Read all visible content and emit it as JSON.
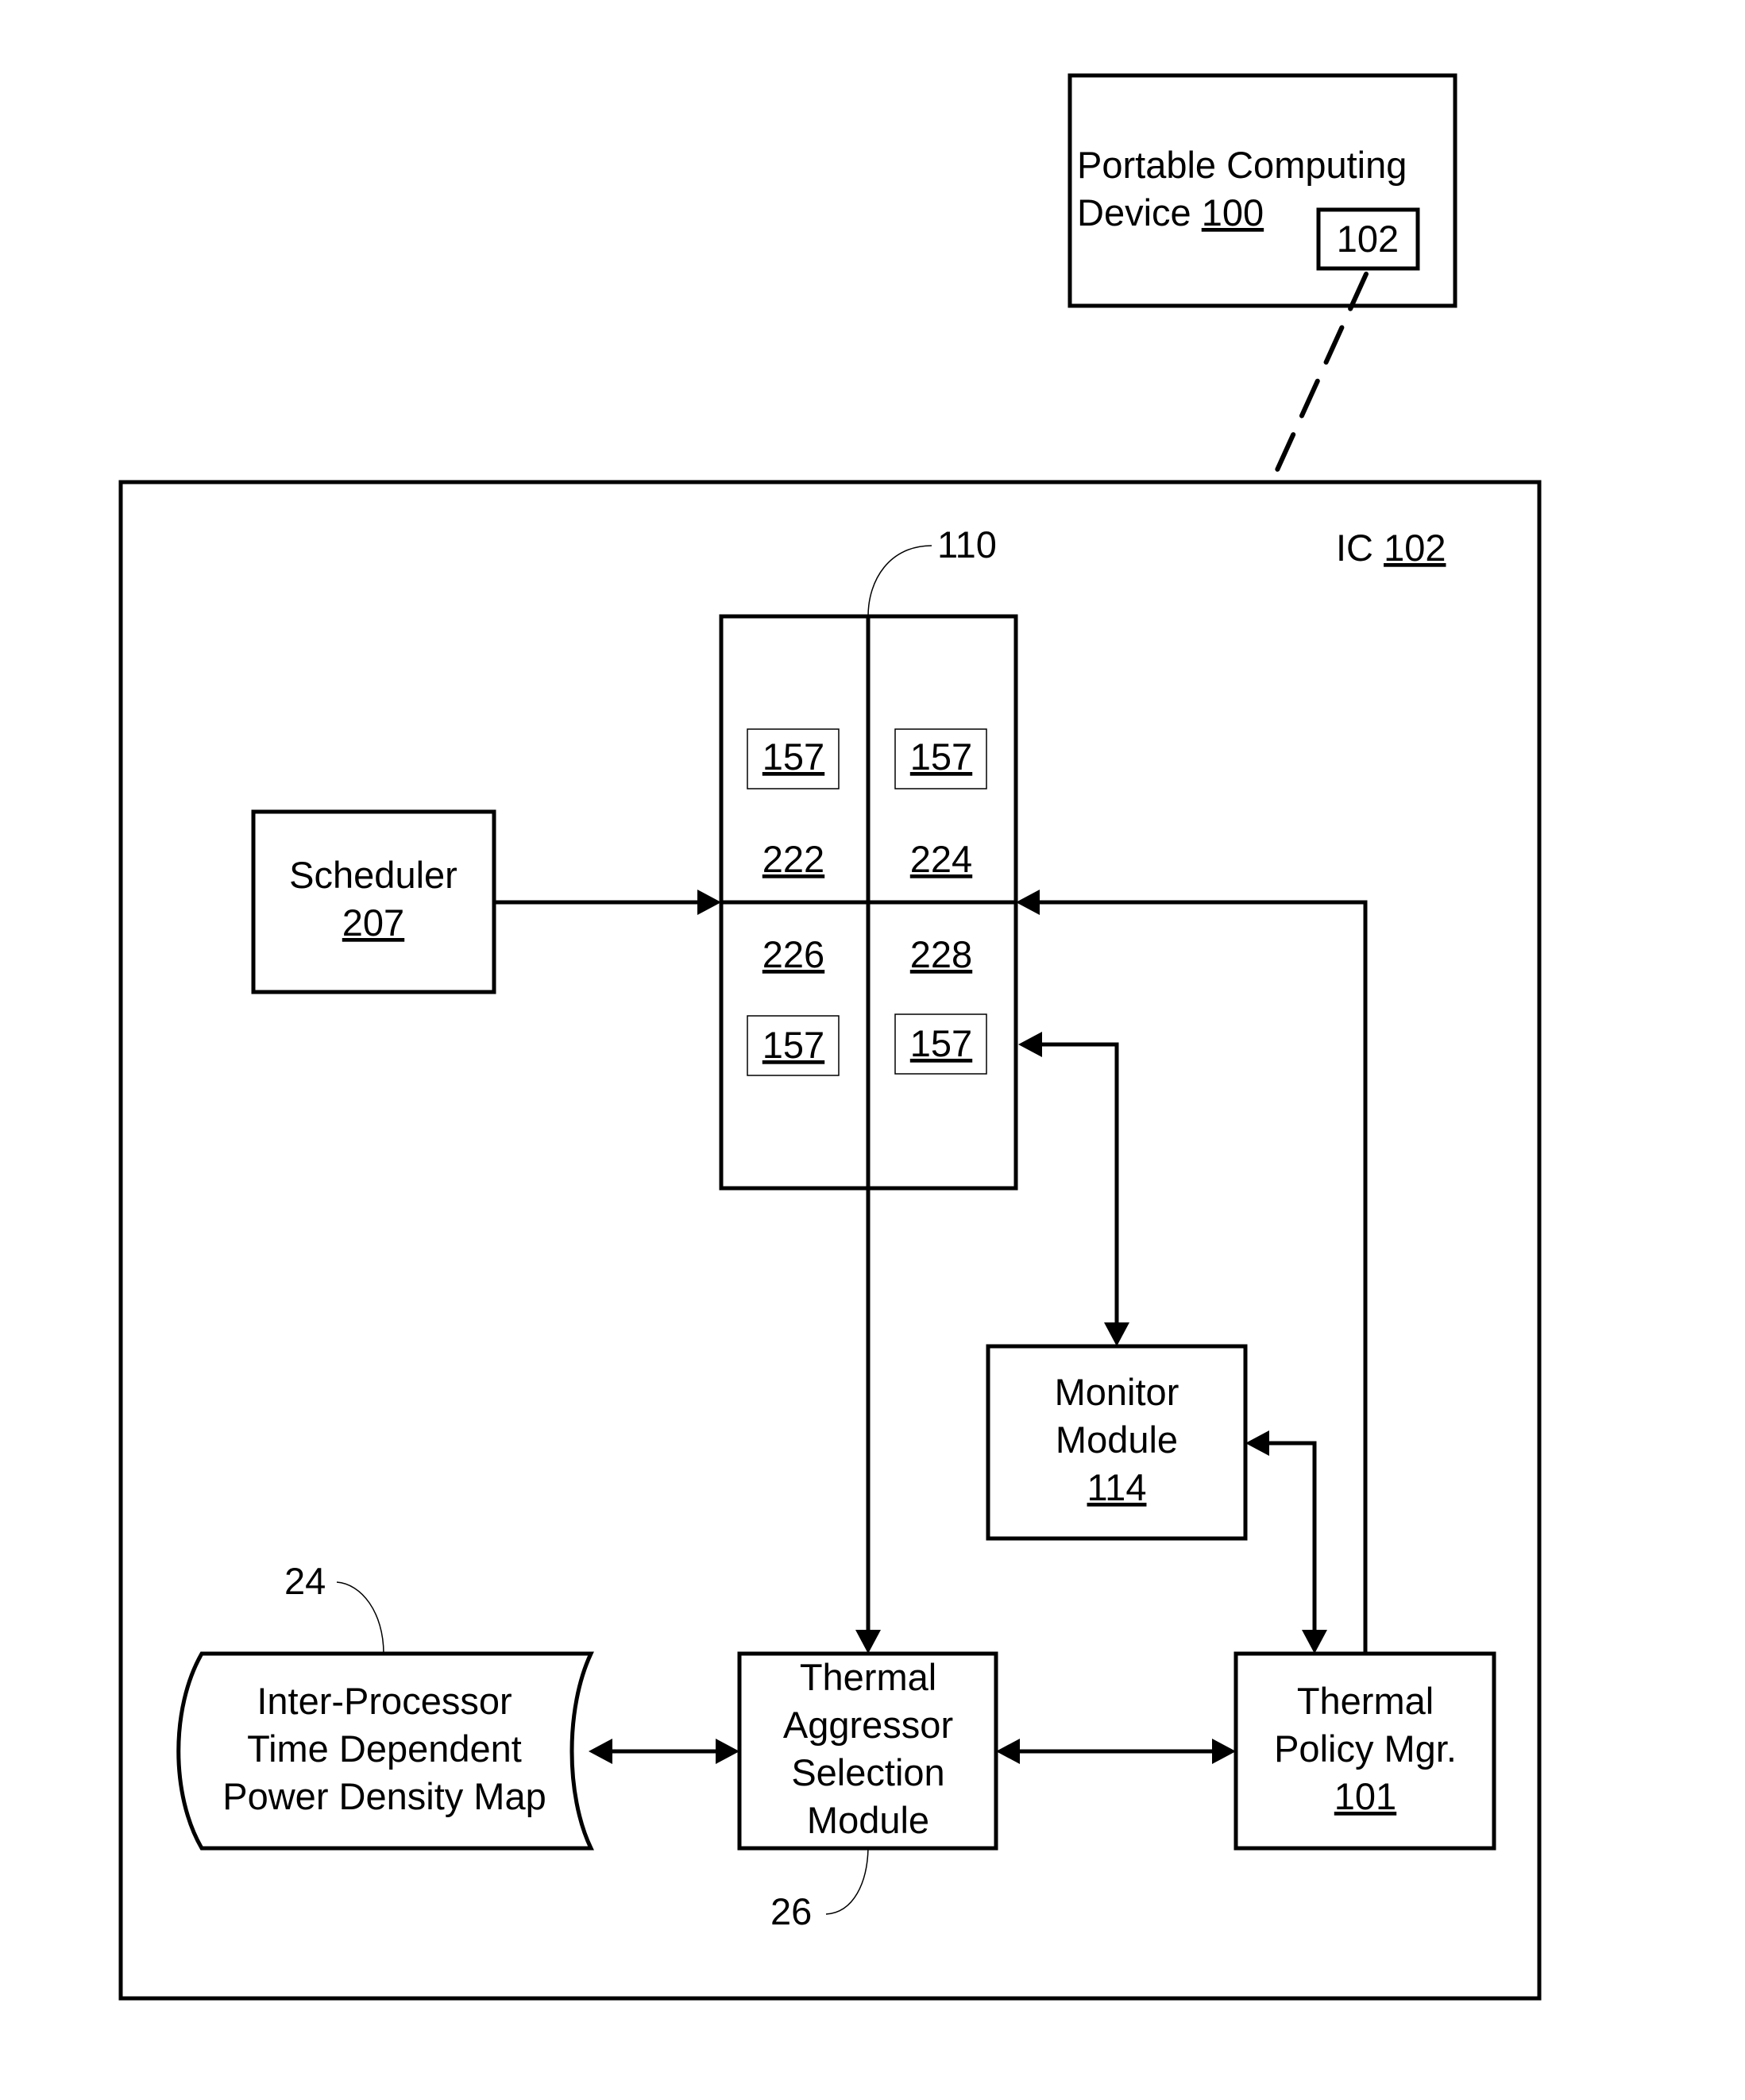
{
  "portable_device": {
    "line1": "Portable Computing",
    "line2_prefix": "Device ",
    "ref": "100",
    "chip_ref": "102"
  },
  "ic": {
    "label_prefix": "IC ",
    "ref": "102"
  },
  "processor": {
    "ref_label": "110",
    "cores": [
      {
        "ref": "222",
        "sensor_ref": "157"
      },
      {
        "ref": "224",
        "sensor_ref": "157"
      },
      {
        "ref": "226",
        "sensor_ref": "157"
      },
      {
        "ref": "228",
        "sensor_ref": "157"
      }
    ]
  },
  "scheduler": {
    "name": "Scheduler",
    "ref": "207"
  },
  "monitor": {
    "line1": "Monitor",
    "line2": "Module",
    "ref": "114"
  },
  "power_map": {
    "ref_label": "24",
    "line1": "Inter-Processor",
    "line2": "Time Dependent",
    "line3": "Power Density Map"
  },
  "aggressor": {
    "ref_label": "26",
    "line1": "Thermal",
    "line2": "Aggressor",
    "line3": "Selection",
    "line4": "Module"
  },
  "policy_mgr": {
    "line1": "Thermal",
    "line2": "Policy Mgr.",
    "ref": "101"
  }
}
